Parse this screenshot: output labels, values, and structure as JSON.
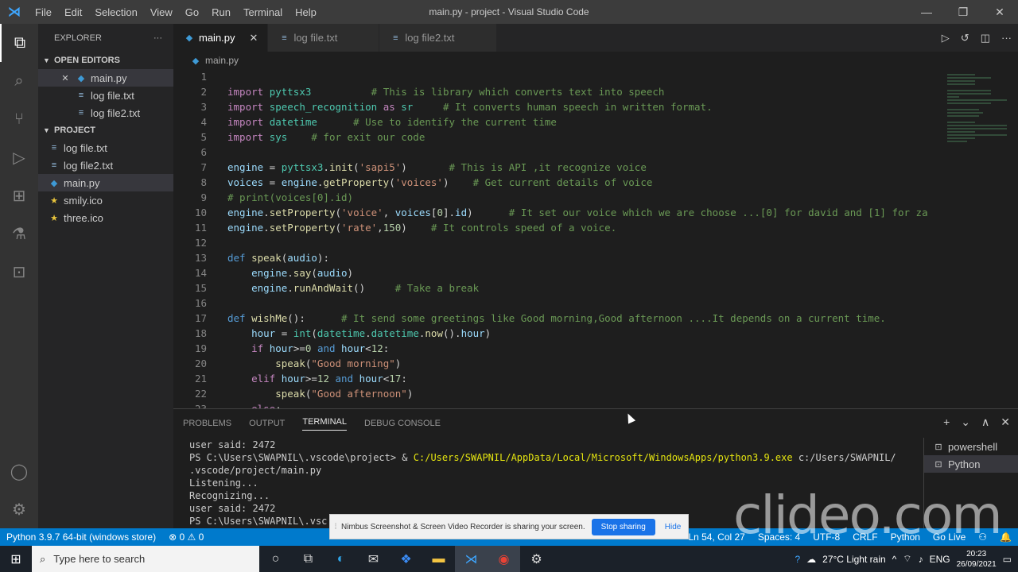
{
  "window": {
    "title": "main.py - project - Visual Studio Code",
    "menu": [
      "File",
      "Edit",
      "Selection",
      "View",
      "Go",
      "Run",
      "Terminal",
      "Help"
    ],
    "controls": {
      "minimize": "—",
      "restore": "❐",
      "close": "✕"
    }
  },
  "activity_bar": {
    "top": [
      {
        "name": "files-icon",
        "glyph": "⧉"
      },
      {
        "name": "search-icon",
        "glyph": "⌕"
      },
      {
        "name": "source-control-icon",
        "glyph": "⑂"
      },
      {
        "name": "run-debug-icon",
        "glyph": "▷"
      },
      {
        "name": "extensions-icon",
        "glyph": "⊞"
      },
      {
        "name": "testing-icon",
        "glyph": "⚗"
      },
      {
        "name": "remote-explorer-icon",
        "glyph": "⊡"
      }
    ],
    "bottom": [
      {
        "name": "account-icon",
        "glyph": "◯"
      },
      {
        "name": "settings-gear-icon",
        "glyph": "⚙"
      }
    ]
  },
  "sidebar": {
    "title": "EXPLORER",
    "more": "···",
    "open_editors_title": "OPEN EDITORS",
    "open_editors": [
      {
        "label": "main.py",
        "close": "✕",
        "icon": "python-file-icon",
        "sel": true
      },
      {
        "label": "log file.txt",
        "icon": "text-file-icon",
        "sel": false
      },
      {
        "label": "log file2.txt",
        "icon": "text-file-icon",
        "sel": false
      }
    ],
    "project_title": "PROJECT",
    "project_files": [
      {
        "label": "log file.txt",
        "icon": "text-file-icon",
        "sel": false
      },
      {
        "label": "log file2.txt",
        "icon": "text-file-icon",
        "sel": false
      },
      {
        "label": "main.py",
        "icon": "python-file-icon",
        "sel": true
      },
      {
        "label": "smily.ico",
        "icon": "star-icon",
        "sel": false
      },
      {
        "label": "three.ico",
        "icon": "star-icon",
        "sel": false
      }
    ]
  },
  "tabs": [
    {
      "label": "main.py",
      "active": true,
      "close": "✕"
    },
    {
      "label": "log file.txt",
      "active": false
    },
    {
      "label": "log file2.txt",
      "active": false
    }
  ],
  "breadcrumb": "main.py",
  "code_lines": [
    [],
    [
      [
        "kw2",
        "import"
      ],
      [
        "code",
        " "
      ],
      [
        "ty",
        "pyttsx3"
      ],
      [
        "code",
        "          "
      ],
      [
        "cm",
        "# This is library which converts text into speech"
      ]
    ],
    [
      [
        "kw2",
        "import"
      ],
      [
        "code",
        " "
      ],
      [
        "ty",
        "speech_recognition"
      ],
      [
        "code",
        " "
      ],
      [
        "kw2",
        "as"
      ],
      [
        "code",
        " "
      ],
      [
        "ty",
        "sr"
      ],
      [
        "code",
        "     "
      ],
      [
        "cm",
        "# It converts human speech in written format."
      ]
    ],
    [
      [
        "kw2",
        "import"
      ],
      [
        "code",
        " "
      ],
      [
        "ty",
        "datetime"
      ],
      [
        "code",
        "      "
      ],
      [
        "cm",
        "# Use to identify the current time"
      ]
    ],
    [
      [
        "kw2",
        "import"
      ],
      [
        "code",
        " "
      ],
      [
        "ty",
        "sys"
      ],
      [
        "code",
        "    "
      ],
      [
        "cm",
        "# for exit our code"
      ]
    ],
    [],
    [
      [
        "va",
        "engine"
      ],
      [
        "code",
        " = "
      ],
      [
        "ty",
        "pyttsx3"
      ],
      [
        "code",
        "."
      ],
      [
        "fn",
        "init"
      ],
      [
        "code",
        "("
      ],
      [
        "st",
        "'sapi5'"
      ],
      [
        "code",
        ")       "
      ],
      [
        "cm",
        "# This is API ,it recognize voice"
      ]
    ],
    [
      [
        "va",
        "voices"
      ],
      [
        "code",
        " = "
      ],
      [
        "va",
        "engine"
      ],
      [
        "code",
        "."
      ],
      [
        "fn",
        "getProperty"
      ],
      [
        "code",
        "("
      ],
      [
        "st",
        "'voices'"
      ],
      [
        "code",
        ")    "
      ],
      [
        "cm",
        "# Get current details of voice"
      ]
    ],
    [
      [
        "cm",
        "# print(voices[0].id)"
      ]
    ],
    [
      [
        "va",
        "engine"
      ],
      [
        "code",
        "."
      ],
      [
        "fn",
        "setProperty"
      ],
      [
        "code",
        "("
      ],
      [
        "st",
        "'voice'"
      ],
      [
        "code",
        ", "
      ],
      [
        "va",
        "voices"
      ],
      [
        "code",
        "["
      ],
      [
        "nu",
        "0"
      ],
      [
        "code",
        "]."
      ],
      [
        "va",
        "id"
      ],
      [
        "code",
        ")      "
      ],
      [
        "cm",
        "# It set our voice which we are choose ...[0] for david and [1] for za"
      ]
    ],
    [
      [
        "va",
        "engine"
      ],
      [
        "code",
        "."
      ],
      [
        "fn",
        "setProperty"
      ],
      [
        "code",
        "("
      ],
      [
        "st",
        "'rate'"
      ],
      [
        "code",
        ","
      ],
      [
        "nu",
        "150"
      ],
      [
        "code",
        ")    "
      ],
      [
        "cm",
        "# It controls speed of a voice."
      ]
    ],
    [],
    [
      [
        "kw",
        "def"
      ],
      [
        "code",
        " "
      ],
      [
        "fn",
        "speak"
      ],
      [
        "code",
        "("
      ],
      [
        "va",
        "audio"
      ],
      [
        "code",
        "):"
      ]
    ],
    [
      [
        "code",
        "    "
      ],
      [
        "va",
        "engine"
      ],
      [
        "code",
        "."
      ],
      [
        "fn",
        "say"
      ],
      [
        "code",
        "("
      ],
      [
        "va",
        "audio"
      ],
      [
        "code",
        ")"
      ]
    ],
    [
      [
        "code",
        "    "
      ],
      [
        "va",
        "engine"
      ],
      [
        "code",
        "."
      ],
      [
        "fn",
        "runAndWait"
      ],
      [
        "code",
        "()     "
      ],
      [
        "cm",
        "# Take a break"
      ]
    ],
    [],
    [
      [
        "kw",
        "def"
      ],
      [
        "code",
        " "
      ],
      [
        "fn",
        "wishMe"
      ],
      [
        "code",
        "():      "
      ],
      [
        "cm",
        "# It send some greetings like Good morning,Good afternoon ....It depends on a current time."
      ]
    ],
    [
      [
        "code",
        "    "
      ],
      [
        "va",
        "hour"
      ],
      [
        "code",
        " = "
      ],
      [
        "ty",
        "int"
      ],
      [
        "code",
        "("
      ],
      [
        "ty",
        "datetime"
      ],
      [
        "code",
        "."
      ],
      [
        "ty",
        "datetime"
      ],
      [
        "code",
        "."
      ],
      [
        "fn",
        "now"
      ],
      [
        "code",
        "()."
      ],
      [
        "va",
        "hour"
      ],
      [
        "code",
        ")"
      ]
    ],
    [
      [
        "code",
        "    "
      ],
      [
        "kw2",
        "if"
      ],
      [
        "code",
        " "
      ],
      [
        "va",
        "hour"
      ],
      [
        "code",
        ">="
      ],
      [
        "nu",
        "0"
      ],
      [
        "code",
        " "
      ],
      [
        "kw",
        "and"
      ],
      [
        "code",
        " "
      ],
      [
        "va",
        "hour"
      ],
      [
        "code",
        "<"
      ],
      [
        "nu",
        "12"
      ],
      [
        "code",
        ":"
      ]
    ],
    [
      [
        "code",
        "        "
      ],
      [
        "fn",
        "speak"
      ],
      [
        "code",
        "("
      ],
      [
        "st",
        "\"Good morning\""
      ],
      [
        "code",
        ")"
      ]
    ],
    [
      [
        "code",
        "    "
      ],
      [
        "kw2",
        "elif"
      ],
      [
        "code",
        " "
      ],
      [
        "va",
        "hour"
      ],
      [
        "code",
        ">="
      ],
      [
        "nu",
        "12"
      ],
      [
        "code",
        " "
      ],
      [
        "kw",
        "and"
      ],
      [
        "code",
        " "
      ],
      [
        "va",
        "hour"
      ],
      [
        "code",
        "<"
      ],
      [
        "nu",
        "17"
      ],
      [
        "code",
        ":"
      ]
    ],
    [
      [
        "code",
        "        "
      ],
      [
        "fn",
        "speak"
      ],
      [
        "code",
        "("
      ],
      [
        "st",
        "\"Good afternoon\""
      ],
      [
        "code",
        ")"
      ]
    ],
    [
      [
        "code",
        "    "
      ],
      [
        "kw2",
        "else"
      ],
      [
        "code",
        ":"
      ]
    ]
  ],
  "panel": {
    "tabs": [
      "PROBLEMS",
      "OUTPUT",
      "TERMINAL",
      "DEBUG CONSOLE"
    ],
    "active_tab": "TERMINAL",
    "actions": {
      "add": "+",
      "split": "⌄",
      "maximize": "∧",
      "close": "✕"
    },
    "terminal_lines": [
      {
        "text": "user said: 2472"
      },
      {
        "pre": "PS C:\\Users\\SWAPNIL\\.vscode\\project> & ",
        "exe": "C:/Users/SWAPNIL/AppData/Local/Microsoft/WindowsApps/python3.9.exe",
        "post": " c:/Users/SWAPNIL/"
      },
      {
        "text": ".vscode/project/main.py"
      },
      {
        "text": "Listening..."
      },
      {
        "text": "Recognizing..."
      },
      {
        "text": "user said: 2472"
      },
      {
        "text": "PS C:\\Users\\SWAPNIL\\.vsc"
      }
    ],
    "terminal_list": [
      {
        "label": "powershell",
        "sel": false
      },
      {
        "label": "Python",
        "sel": true
      }
    ]
  },
  "statusbar": {
    "interpreter": "Python 3.9.7 64-bit (windows store)",
    "problems": "⊗ 0 ⚠ 0",
    "position": "Ln 54, Col 27",
    "spaces": "Spaces: 4",
    "encoding": "UTF-8",
    "eol": "CRLF",
    "language": "Python",
    "golive": "Go Live"
  },
  "share_bar": {
    "message": "Nimbus Screenshot & Screen Video Recorder is sharing your screen.",
    "stop": "Stop sharing",
    "hide": "Hide"
  },
  "watermark": "clideo.com",
  "taskbar": {
    "search_placeholder": "Type here to search",
    "weather": "27°C  Light rain",
    "lang": "ENG",
    "time": "20:23",
    "date": "26/09/2021"
  }
}
